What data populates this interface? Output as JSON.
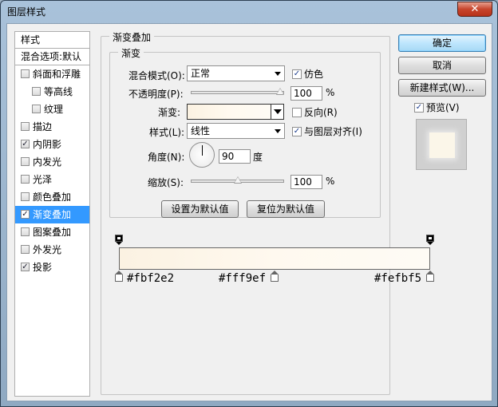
{
  "window": {
    "title": "图层样式",
    "close_glyph": "✕"
  },
  "style_list": {
    "header": "样式",
    "blend_options": "混合选项:默认",
    "items": [
      {
        "label": "斜面和浮雕",
        "checked": false,
        "indent": false
      },
      {
        "label": "等高线",
        "checked": false,
        "indent": true
      },
      {
        "label": "纹理",
        "checked": false,
        "indent": true
      },
      {
        "label": "描边",
        "checked": false,
        "indent": false
      },
      {
        "label": "内阴影",
        "checked": true,
        "indent": false
      },
      {
        "label": "内发光",
        "checked": false,
        "indent": false
      },
      {
        "label": "光泽",
        "checked": false,
        "indent": false
      },
      {
        "label": "颜色叠加",
        "checked": false,
        "indent": false
      },
      {
        "label": "渐变叠加",
        "checked": true,
        "indent": false,
        "selected": true
      },
      {
        "label": "图案叠加",
        "checked": false,
        "indent": false
      },
      {
        "label": "外发光",
        "checked": false,
        "indent": false
      },
      {
        "label": "投影",
        "checked": true,
        "indent": false
      }
    ]
  },
  "panel": {
    "group_title": "渐变叠加",
    "sub_group_title": "渐变",
    "blend_mode_label": "混合模式(O):",
    "blend_mode_value": "正常",
    "dither_label": "仿色",
    "dither_checked": true,
    "opacity_label": "不透明度(P):",
    "opacity_value": "100",
    "opacity_fraction": 1.0,
    "percent": "%",
    "gradient_label": "渐变:",
    "reverse_label": "反向(R)",
    "reverse_checked": false,
    "style_label": "样式(L):",
    "style_value": "线性",
    "align_label": "与图层对齐(I)",
    "align_checked": true,
    "angle_label": "角度(N):",
    "angle_value": "90",
    "angle_unit": "度",
    "scale_label": "缩放(S):",
    "scale_value": "100",
    "scale_fraction": 0.5,
    "set_default_button": "设置为默认值",
    "reset_default_button": "复位为默认值"
  },
  "gradient_editor": {
    "colors": [
      "#fbf2e2",
      "#fff9ef",
      "#fefbf5"
    ],
    "stops": [
      {
        "color": "#fbf2e2",
        "location": 0.0
      },
      {
        "color": "#fff9ef",
        "location": 0.5
      },
      {
        "color": "#fefbf5",
        "location": 1.0
      }
    ],
    "opacity_stops": [
      0.0,
      1.0
    ]
  },
  "right": {
    "ok_button": "确定",
    "cancel_button": "取消",
    "new_style_button": "新建样式(W)...",
    "preview_label": "预览(V)",
    "preview_checked": true
  },
  "icons": {
    "check": "✓",
    "close": "close-icon",
    "dropdown": "chevron-down-icon"
  }
}
